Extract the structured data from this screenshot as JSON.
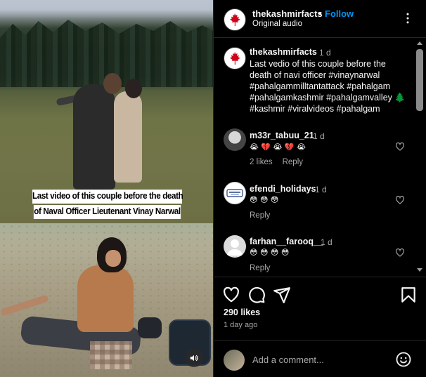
{
  "video": {
    "caption_line1": "Last video of this couple before the death",
    "caption_line2": "of Naval Officer Lieutenant Vinay Narwal",
    "icons": {
      "mute": "volume-icon"
    }
  },
  "header": {
    "username": "thekashmirfacts",
    "separator": "•",
    "follow_label": "Follow",
    "audio": "Original audio",
    "brand_color": "#d0021b",
    "follow_color": "#0095f6"
  },
  "caption": {
    "username": "thekashmirfacts",
    "time": "1 d",
    "line1": "Last vedio of this couple before the",
    "line2": "death of navi officer #vinaynarwal",
    "line3": "#pahalgammilltantattack #pahalgam",
    "line4": "#pahalgamkashmir #pahalgamvalley 🌲",
    "line5": "#kashmir #viralvideos #pahalgam"
  },
  "comments": [
    {
      "username": "m33r_tabuu_21",
      "time": "1 d",
      "text": "😭 💔 😭 💔 😭",
      "likes": "2 likes",
      "reply": "Reply"
    },
    {
      "username": "efendi_holidays",
      "time": "1 d",
      "text": "😳 😳 😳",
      "reply": "Reply"
    },
    {
      "username": "farhan__farooq__",
      "time": "1 d",
      "text": "😳 😳 😳 😳",
      "reply": "Reply"
    }
  ],
  "actions": {
    "likes": "290 likes",
    "age": "1 day ago",
    "icons": [
      "heart-icon",
      "comment-icon",
      "share-icon",
      "bookmark-icon"
    ]
  },
  "add_comment": {
    "placeholder": "Add a comment...",
    "icons": {
      "emoji": "smiley-icon"
    }
  }
}
